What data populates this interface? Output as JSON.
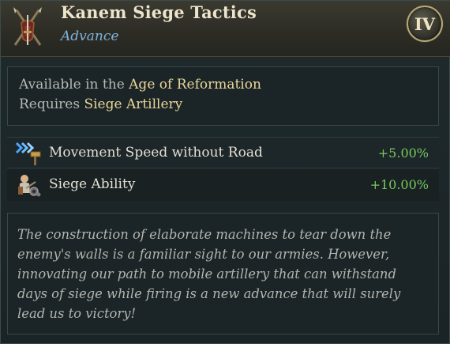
{
  "header": {
    "title": "Kanem Siege Tactics",
    "subtitle": "Advance",
    "tier": "IV",
    "icon": "crossed-weapons-icon"
  },
  "requirements": {
    "line1_prefix": "Available in the ",
    "line1_value": "Age of Reformation",
    "line2_prefix": "Requires ",
    "line2_value": "Siege Artillery"
  },
  "modifiers": [
    {
      "label": "Movement Speed without Road",
      "value": "+5.00%",
      "icon": "speed-arrows-road-icon"
    },
    {
      "label": "Siege Ability",
      "value": "+10.00%",
      "icon": "siege-engineer-icon"
    }
  ],
  "description": "The construction of elaborate machines to tear down the enemy's walls is a familiar sight to our armies. However, innovating our path to mobile artillery that can withstand days of siege while firing is a new advance that will surely lead us to victory!",
  "colors": {
    "highlight": "#e9d79a",
    "positive": "#78c95e",
    "subtitle": "#7fb3d9"
  }
}
